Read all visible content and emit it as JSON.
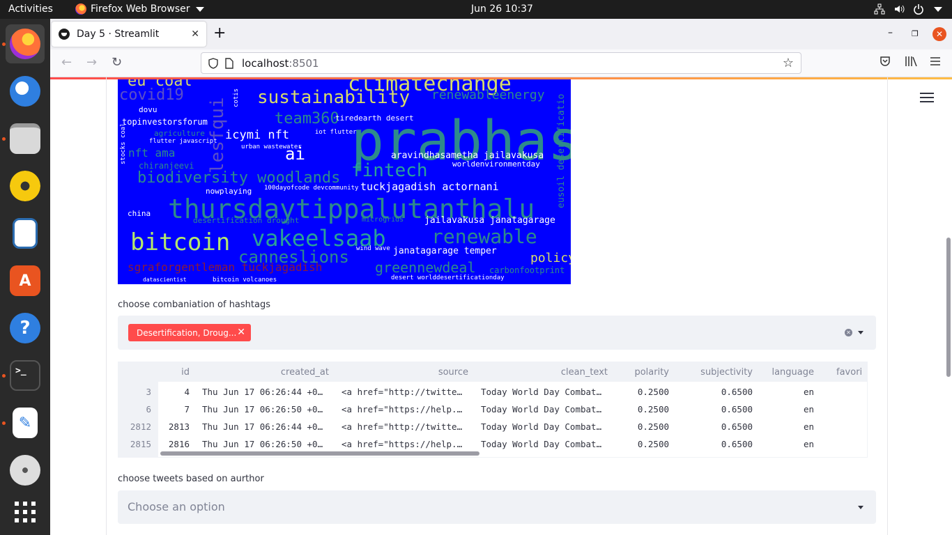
{
  "topbar": {
    "activities": "Activities",
    "app_name": "Firefox Web Browser",
    "clock": "Jun 26  10:37"
  },
  "browser": {
    "tab_title": "Day 5 · Streamlit",
    "url_host": "localhost",
    "url_port": ":8501"
  },
  "wordcloud": {
    "words": [
      {
        "text": "prabhas",
        "color": "#2e8b8b"
      },
      {
        "text": "thursdaytippalutanthalu",
        "color": "#2e8b8b"
      },
      {
        "text": "vakeelsaab",
        "color": "#2aa198"
      },
      {
        "text": "bitcoin",
        "color": "#b5e86b"
      },
      {
        "text": "sustainability",
        "color": "#d7dc6a"
      },
      {
        "text": "climatechange",
        "color": "#d7dc6a"
      },
      {
        "text": "eu coal",
        "color": "#d7dc6a"
      },
      {
        "text": "covid19",
        "color": "#5a4fc8"
      },
      {
        "text": "renewableenergy",
        "color": "#2e8b8b"
      },
      {
        "text": "team360",
        "color": "#2e8b8b"
      },
      {
        "text": "fintech",
        "color": "#2aa198"
      },
      {
        "text": "biodiversity woodlands",
        "color": "#2e8b8b"
      },
      {
        "text": "renewable",
        "color": "#2e8b8b"
      },
      {
        "text": "canneslions",
        "color": "#2e8b8b"
      },
      {
        "text": "greennewdeal",
        "color": "#2e8b8b"
      },
      {
        "text": "policy",
        "color": "#d7dc6a"
      },
      {
        "text": "icymi nft",
        "color": "#ffffff"
      },
      {
        "text": "ai",
        "color": "#ffffff"
      },
      {
        "text": "nft ama",
        "color": "#2e8b8b"
      },
      {
        "text": "lesfqui",
        "color": "#5a4fc8"
      },
      {
        "text": "aravindhasametha jailavakusa",
        "color": "#ffffff"
      },
      {
        "text": "tuckjagadish actornani",
        "color": "#ffffff"
      },
      {
        "text": "jailavakusa janatagarage",
        "color": "#ffffff"
      },
      {
        "text": "janatagarage temper",
        "color": "#ffffff"
      },
      {
        "text": "worldenvironmentday",
        "color": "#ffffff"
      },
      {
        "text": "topinvestorsforum",
        "color": "#ffffff"
      },
      {
        "text": "agriculture",
        "color": "#2e8b8b"
      },
      {
        "text": "chiranjeevi",
        "color": "#2e8b8b"
      },
      {
        "text": "nowplaying",
        "color": "#ffffff"
      },
      {
        "text": "china",
        "color": "#ffffff"
      },
      {
        "text": "carbonfootprint",
        "color": "#2e8b8b"
      },
      {
        "text": "desert worlddesertificationday",
        "color": "#ffffff"
      },
      {
        "text": "tiredearth desert",
        "color": "#ffffff"
      },
      {
        "text": "dovu",
        "color": "#ffffff"
      },
      {
        "text": "flutter javascript",
        "color": "#ffffff"
      },
      {
        "text": "iot flutter",
        "color": "#ffffff"
      },
      {
        "text": "urban wastewater",
        "color": "#ffffff"
      },
      {
        "text": "eusoil desertificatio",
        "color": "#2e8b8b"
      },
      {
        "text": "desertification drought",
        "color": "#2e8b8b"
      },
      {
        "text": "microgrids",
        "color": "#2e8b8b"
      },
      {
        "text": "bitcoin volcanoes",
        "color": "#ffffff"
      },
      {
        "text": "datascientist",
        "color": "#ffffff"
      },
      {
        "text": "100dayofcode devcommunity",
        "color": "#ffffff"
      },
      {
        "text": "stocks coal",
        "color": "#ffffff"
      },
      {
        "text": "cotis",
        "color": "#ffffff"
      },
      {
        "text": "wind wave",
        "color": "#ffffff"
      },
      {
        "text": "sgraforgentleman tuckjagadish",
        "color": "#8b1a3a"
      }
    ]
  },
  "hashtag_select": {
    "label": "choose combaniation of hashtags",
    "chip": "Desertification, Droug...",
    "chip_close": "✕",
    "clear": "✕"
  },
  "dataframe": {
    "columns": [
      "id",
      "created_at",
      "source",
      "clean_text",
      "polarity",
      "subjectivity",
      "language",
      "favori"
    ],
    "rows": [
      {
        "index": "3",
        "cells": [
          "4",
          "Thu Jun 17 06:26:44 +0…",
          "<a href=\"http://twitte…",
          "Today World Day Combat…",
          "0.2500",
          "0.6500",
          "en",
          ""
        ]
      },
      {
        "index": "6",
        "cells": [
          "7",
          "Thu Jun 17 06:26:50 +0…",
          "<a href=\"https://help.…",
          "Today World Day Combat…",
          "0.2500",
          "0.6500",
          "en",
          ""
        ]
      },
      {
        "index": "2812",
        "cells": [
          "2813",
          "Thu Jun 17 06:26:44 +0…",
          "<a href=\"http://twitte…",
          "Today World Day Combat…",
          "0.2500",
          "0.6500",
          "en",
          ""
        ]
      },
      {
        "index": "2815",
        "cells": [
          "2816",
          "Thu Jun 17 06:26:50 +0…",
          "<a href=\"https://help.…",
          "Today World Day Combat…",
          "0.2500",
          "0.6500",
          "en",
          ""
        ]
      }
    ]
  },
  "author_select": {
    "label": "choose tweets based on aurthor",
    "placeholder": "Choose an option"
  },
  "colors": {
    "accent": "#ff4b4b",
    "wordcloud_bg": "#0000ff",
    "widget_bg": "#f0f2f6"
  }
}
